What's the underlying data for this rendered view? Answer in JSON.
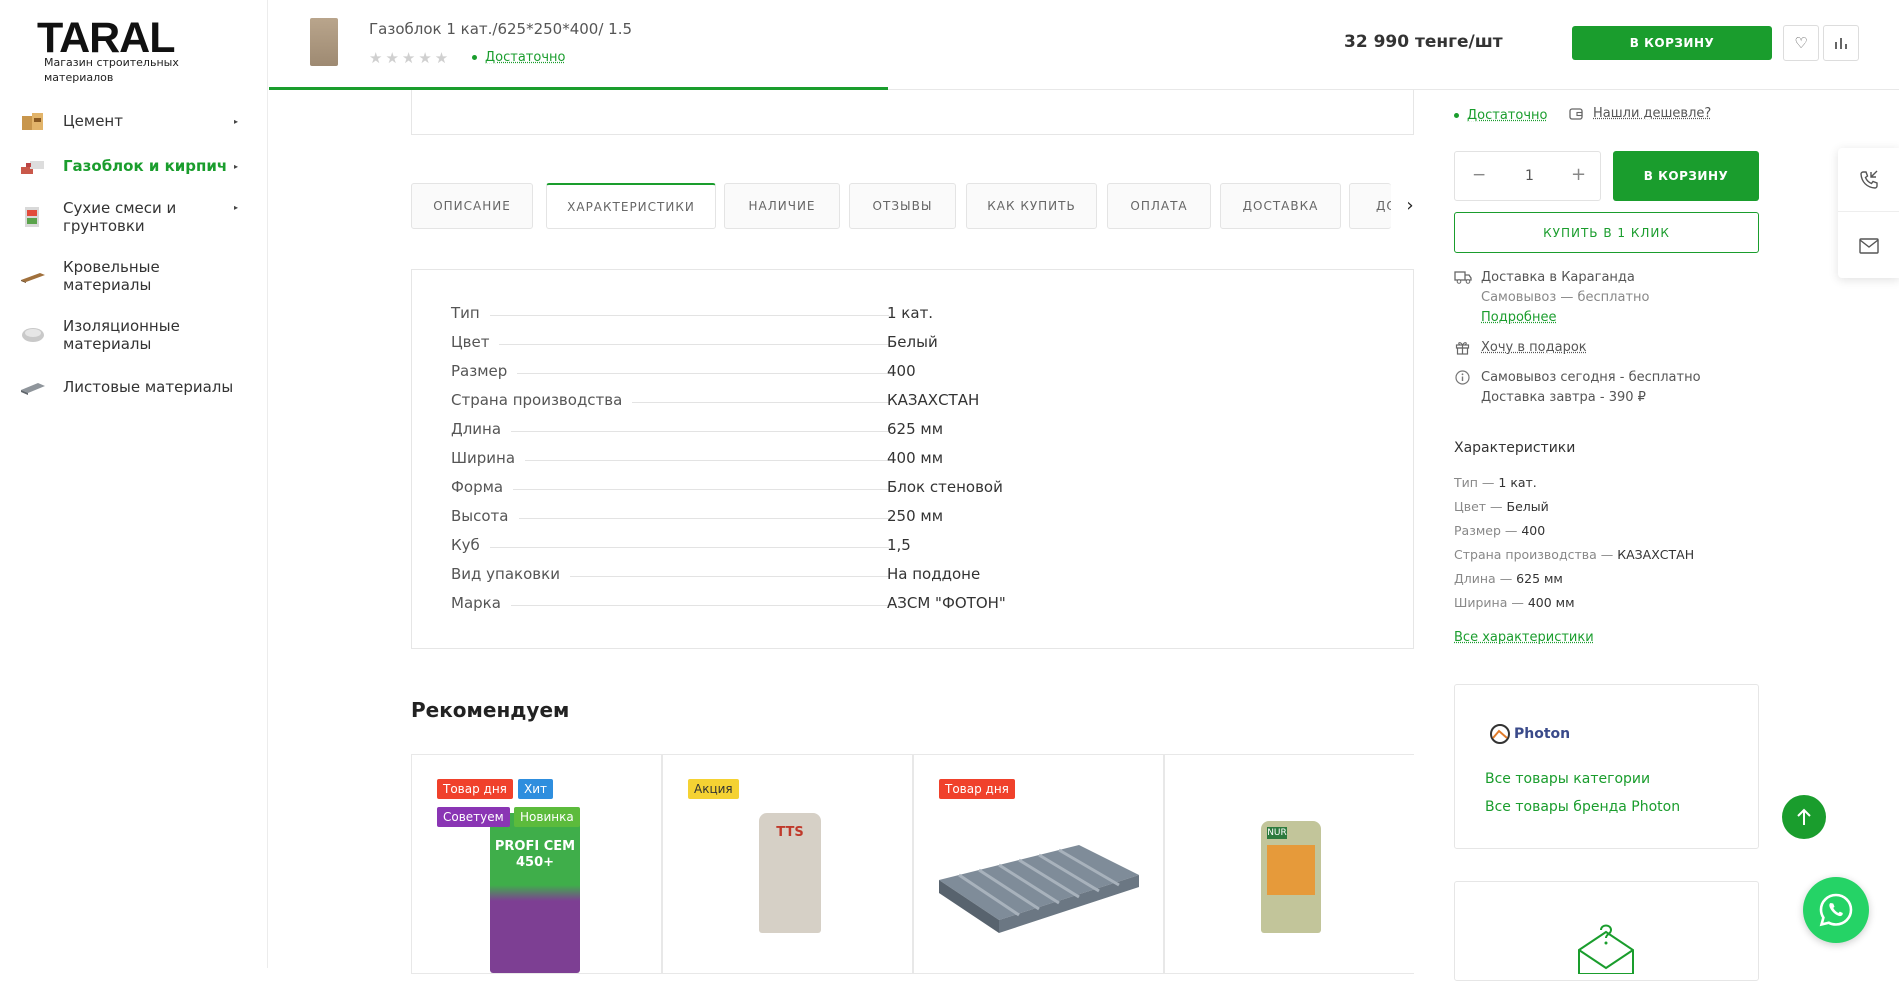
{
  "sidebar": {
    "logo": "TARAL",
    "logo_sub": "Магазин строительных материалов",
    "items": [
      {
        "label": "Цемент"
      },
      {
        "label": "Газоблок и кирпич"
      },
      {
        "label": "Сухие смеси и грунтовки"
      },
      {
        "label": "Кровельные материалы"
      },
      {
        "label": "Изоляционные материалы"
      },
      {
        "label": "Листовые материалы"
      }
    ]
  },
  "sticky": {
    "title": "Газоблок 1 кат./625*250*400/ 1.5",
    "stars": "★★★★★",
    "availability": "Достаточно",
    "price": "32 990 тенге/шт",
    "cart_label": "В КОРЗИНУ",
    "progress": 0.38
  },
  "tabs": [
    "ОПИСАНИЕ",
    "ХАРАКТЕРИСТИКИ",
    "НАЛИЧИЕ",
    "ОТЗЫВЫ",
    "КАК КУПИТЬ",
    "ОПЛАТА",
    "ДОСТАВКА",
    "ДО"
  ],
  "specs": [
    {
      "name": "Тип",
      "value": "1 кат."
    },
    {
      "name": "Цвет",
      "value": "Белый"
    },
    {
      "name": "Размер",
      "value": "400"
    },
    {
      "name": "Страна производства",
      "value": "КАЗАХСТАН"
    },
    {
      "name": "Длина",
      "value": "625 мм"
    },
    {
      "name": "Ширина",
      "value": "400 мм"
    },
    {
      "name": "Форма",
      "value": "Блок стеновой"
    },
    {
      "name": "Высота",
      "value": "250 мм"
    },
    {
      "name": "Куб",
      "value": "1,5"
    },
    {
      "name": "Вид упаковки",
      "value": "На поддоне"
    },
    {
      "name": "Марка",
      "value": "АЗСМ \"ФОТОН\""
    }
  ],
  "recommend": {
    "title": "Рекомендуем",
    "badges": {
      "day": "Товар дня",
      "hit": "Хит",
      "advise": "Советуем",
      "new": "Новинка",
      "sale": "Акция"
    },
    "product1_text": "PROFI CEM 450+",
    "product2_text": "TTS",
    "product4_text": "NUR"
  },
  "right": {
    "availability": "Достаточно",
    "cheaper": "Нашли дешевле?",
    "qty": "1",
    "minus": "−",
    "plus": "+",
    "cart_label": "В КОРЗИНУ",
    "one_click": "КУПИТЬ В 1 КЛИК",
    "delivery_city": "Доставка в Караганда",
    "pickup": "Самовывоз — бесплатно",
    "more": "Подробнее",
    "gift": "Хочу в подарок",
    "today": "Самовывоз сегодня - бесплатно",
    "tomorrow": "Доставка завтра - 390 ₽",
    "chars_title": "Характеристики",
    "chars": [
      {
        "name": "Тип",
        "value": "1 кат."
      },
      {
        "name": "Цвет",
        "value": "Белый"
      },
      {
        "name": "Размер",
        "value": "400"
      },
      {
        "name": "Страна производства",
        "value": "КАЗАХСТАН"
      },
      {
        "name": "Длина",
        "value": "625 мм"
      },
      {
        "name": "Ширина",
        "value": "400 мм"
      }
    ],
    "all_chars": "Все характеристики",
    "brand": "Photon",
    "all_category": "Все товары категории",
    "all_brand": "Все товары бренда Photon"
  },
  "colors": {
    "accent": "#1a9d2d",
    "badge_red": "#f0412b",
    "badge_blue": "#2e8ede",
    "badge_purple": "#8a35b4",
    "badge_green": "#5cbb3c",
    "badge_yellow": "#f5d233"
  }
}
